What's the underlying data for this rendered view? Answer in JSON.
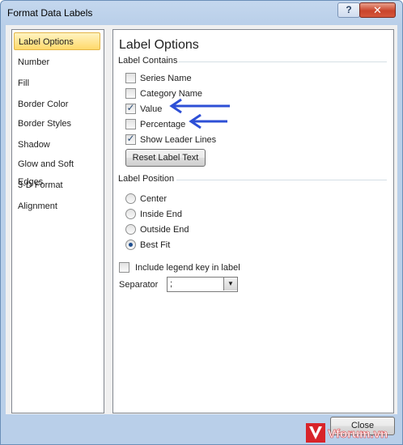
{
  "window": {
    "title": "Format Data Labels",
    "help_label": "?",
    "close_label": "✕"
  },
  "nav": {
    "items": [
      {
        "label": "Label Options",
        "selected": true
      },
      {
        "label": "Number"
      },
      {
        "label": "Fill"
      },
      {
        "label": "Border Color"
      },
      {
        "label": "Border Styles"
      },
      {
        "label": "Shadow"
      },
      {
        "label": "Glow and Soft Edges"
      },
      {
        "label": "3-D Format"
      },
      {
        "label": "Alignment"
      }
    ]
  },
  "panel": {
    "title": "Label Options",
    "label_contains": {
      "heading": "Label Contains",
      "options": [
        {
          "label": "Series Name",
          "checked": false
        },
        {
          "label": "Category Name",
          "checked": false
        },
        {
          "label": "Value",
          "checked": true
        },
        {
          "label": "Percentage",
          "checked": false
        },
        {
          "label": "Show Leader Lines",
          "checked": true
        }
      ],
      "reset_button": "Reset Label Text"
    },
    "label_position": {
      "heading": "Label Position",
      "options": [
        {
          "label": "Center",
          "selected": false
        },
        {
          "label": "Inside End",
          "selected": false
        },
        {
          "label": "Outside End",
          "selected": false
        },
        {
          "label": "Best Fit",
          "selected": true
        }
      ]
    },
    "legend_key": {
      "label": "Include legend key in label",
      "checked": false
    },
    "separator": {
      "label": "Separator",
      "value": ";"
    }
  },
  "footer": {
    "close_button": "Close"
  },
  "watermark": {
    "text": "Vforum.vn"
  },
  "colors": {
    "arrow": "#2d4fd6",
    "selection": "#ffd96b",
    "titlebar": "#b9cfe9"
  }
}
